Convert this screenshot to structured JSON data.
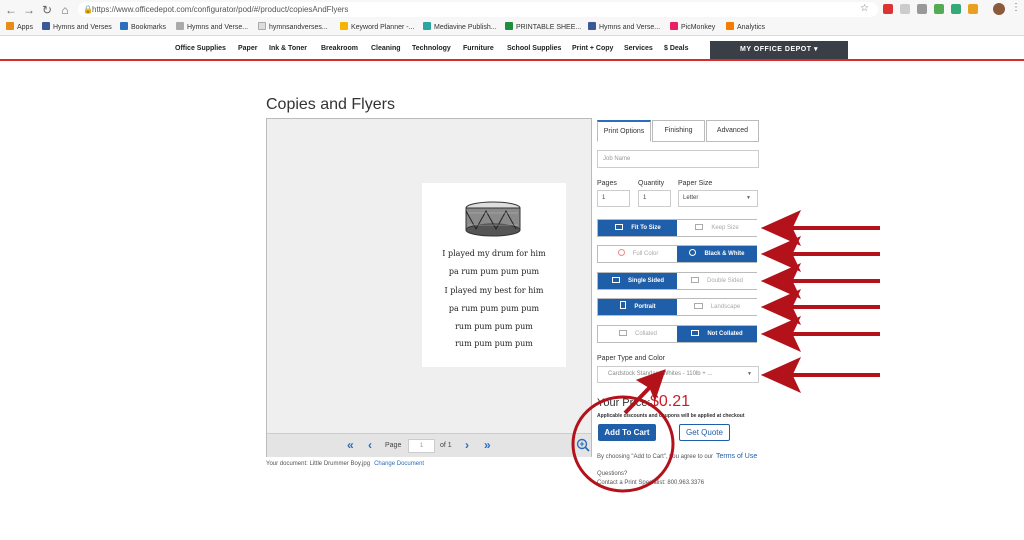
{
  "browser": {
    "url": "https://www.officedepot.com/configurator/pod/#/product/copiesAndFlyers",
    "bookmarks": [
      "Apps",
      "Hymns and Verses",
      "Bookmarks",
      "Hymns and Verse...",
      "hymnsandverses...",
      "Keyword Planner -...",
      "Mediavine Publish...",
      "PRINTABLE SHEE...",
      "Hymns and Verse...",
      "PicMonkey",
      "Analytics"
    ]
  },
  "site_nav": {
    "items": [
      "Office Supplies",
      "Paper",
      "Ink & Toner",
      "Breakroom",
      "Cleaning",
      "Technology",
      "Furniture",
      "School Supplies",
      "Print + Copy",
      "Services",
      "$ Deals"
    ],
    "account_label": "MY OFFICE DEPOT ▾"
  },
  "page": {
    "title": "Copies and Flyers"
  },
  "preview": {
    "verse_lines": [
      "I played my drum for him",
      "pa rum pum pum pum",
      "I played my best for him",
      "pa rum pum pum pum",
      "rum pum pum pum",
      "rum pum pum pum"
    ],
    "page_label": "Page",
    "page_value": "1",
    "of_label": "of 1",
    "document_text": "Your document: Little Drummer Boy.jpg",
    "change_document": "Change Document"
  },
  "options": {
    "tabs": [
      "Print Options",
      "Finishing",
      "Advanced"
    ],
    "job_name_placeholder": "Job Name",
    "pages_label": "Pages",
    "pages_value": "1",
    "quantity_label": "Quantity",
    "quantity_value": "1",
    "paper_size_label": "Paper Size",
    "paper_size_value": "Letter",
    "toggles": [
      {
        "left": "Fit To Size",
        "right": "Keep Size",
        "selected": "left"
      },
      {
        "left": "Full Color",
        "right": "Black & White",
        "selected": "right"
      },
      {
        "left": "Single Sided",
        "right": "Double Sided",
        "selected": "left"
      },
      {
        "left": "Portrait",
        "right": "Landscape",
        "selected": "left"
      },
      {
        "left": "Collated",
        "right": "Not Collated",
        "selected": "right"
      }
    ],
    "paper_type_label": "Paper Type and Color",
    "paper_type_value": "Cardstock Standard Whites - 110lb + ..."
  },
  "pricing": {
    "price_label": "Your Price:",
    "price_value": "$0.21",
    "discount_note": "Applicable discounts and coupons will be applied at checkout",
    "add_to_cart": "Add To Cart",
    "get_quote": "Get Quote",
    "terms_prefix": "By choosing \"Add to Cart\", you agree to our",
    "terms_link": "Terms of Use",
    "questions": "Questions?",
    "contact": "Contact a Print Specialist: 800.963.3376"
  },
  "colors": {
    "primary_blue": "#1f5ea8",
    "price_red": "#c8202a",
    "annotation_red": "#b3121b",
    "nav_accent": "#d82b2b"
  }
}
